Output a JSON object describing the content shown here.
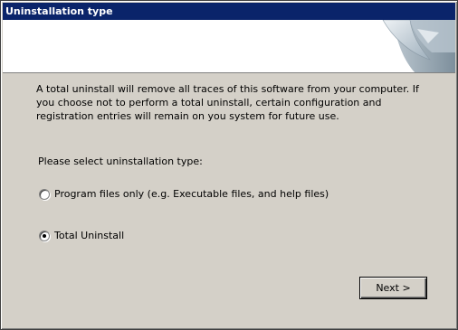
{
  "window": {
    "title": "Uninstallation type"
  },
  "description": "A total uninstall will remove all traces of this software from your computer. If you choose not to perform a total uninstall, certain configuration and registration entries will remain on you system for future use.",
  "prompt": "Please select uninstallation type:",
  "options": [
    {
      "label": "Program files only (e.g. Executable files, and help files)",
      "selected": false
    },
    {
      "label": "Total Uninstall",
      "selected": true
    }
  ],
  "buttons": {
    "next_label": "Next >"
  },
  "colors": {
    "titlebar": "#0a246a",
    "dialog_bg": "#d4d0c8",
    "header_bg": "#ffffff"
  },
  "icons": {
    "header_graphic": "page-curl-icon"
  }
}
